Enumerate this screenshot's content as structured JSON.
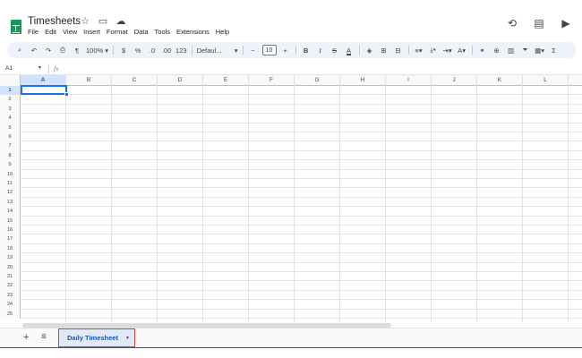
{
  "app": {
    "title": "Timesheets",
    "menu": [
      "File",
      "Edit",
      "View",
      "Insert",
      "Format",
      "Data",
      "Tools",
      "Extensions",
      "Help"
    ]
  },
  "header_icons": [
    "star-icon",
    "move-to-folder-icon",
    "cloud-status-icon",
    "history-icon",
    "comments-icon",
    "meet-icon"
  ],
  "toolbar": {
    "zoom": "100%",
    "currency": "$",
    "percent": "%",
    "decrease_decimal": ".0",
    "increase_decimal": ".00",
    "number_format": "123",
    "font": "Defaul...",
    "font_size": "10",
    "bold": "B",
    "italic": "I",
    "strikethrough": "S",
    "text_color": "A",
    "text_rotation": "A",
    "functions": "Σ"
  },
  "formula_bar": {
    "name_box": "A1",
    "fx": "fx"
  },
  "grid": {
    "columns": [
      "A",
      "B",
      "C",
      "D",
      "E",
      "F",
      "G",
      "H",
      "I",
      "J",
      "K",
      "L"
    ],
    "rows": [
      "1",
      "2",
      "3",
      "4",
      "5",
      "6",
      "7",
      "8",
      "9",
      "10",
      "11",
      "12",
      "13",
      "14",
      "15",
      "16",
      "17",
      "18",
      "19",
      "20",
      "21",
      "22",
      "23",
      "24",
      "25"
    ],
    "selected_cell": "A1"
  },
  "sheets": {
    "add": "+",
    "all": "≡",
    "tabs": [
      {
        "label": "Daily Timesheet",
        "active": true
      }
    ]
  },
  "colors": {
    "accent": "#1a73e8",
    "sheets_green": "#0f9d58",
    "tab_highlight_border": "#e53935"
  }
}
